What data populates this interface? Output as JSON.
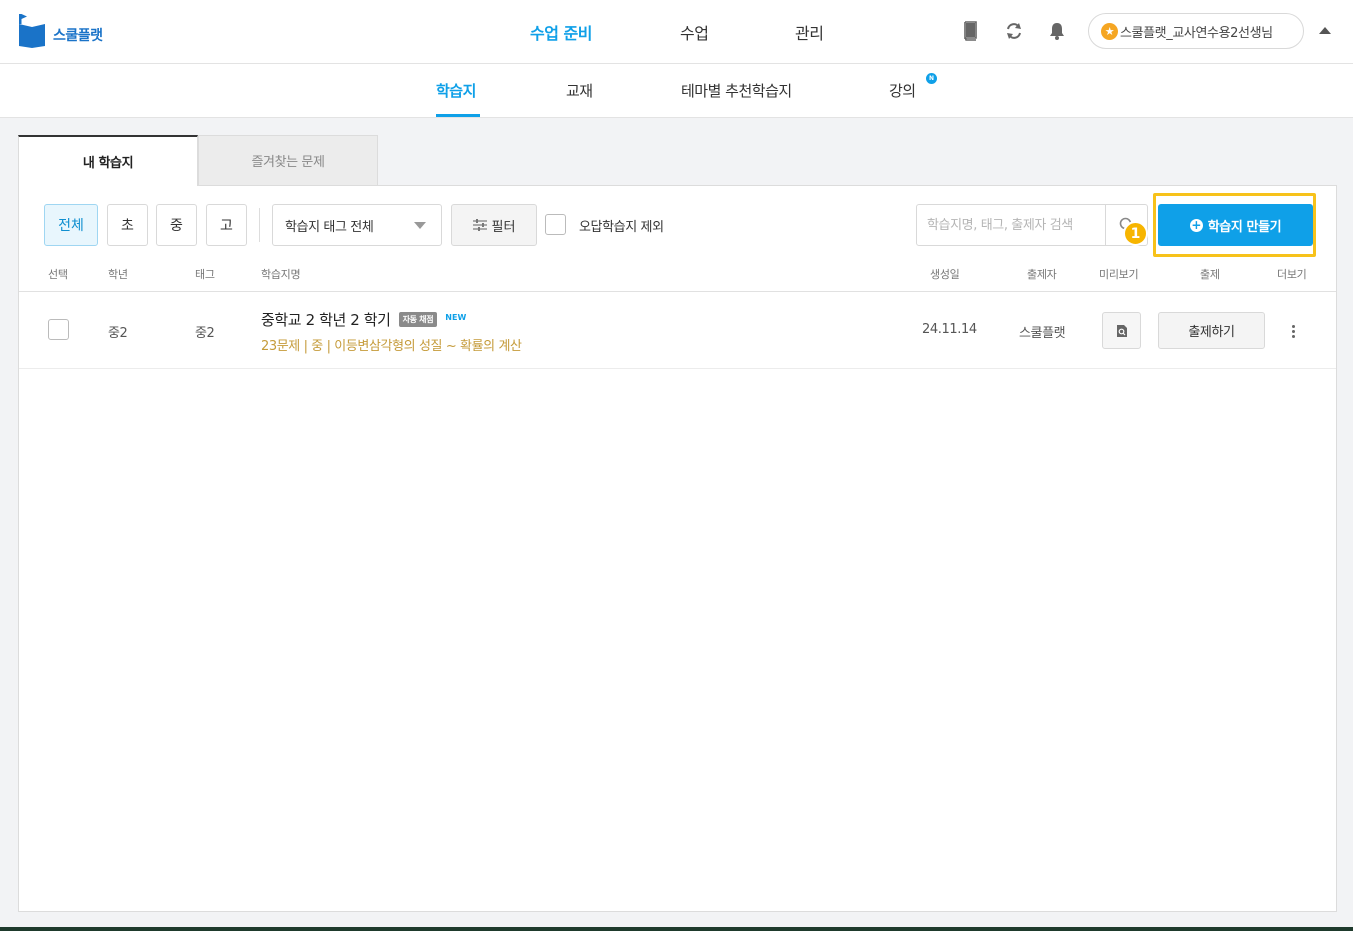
{
  "brand": {
    "name": "스쿨플랫"
  },
  "top_nav": [
    {
      "label": "수업 준비",
      "active": true
    },
    {
      "label": "수업",
      "active": false
    },
    {
      "label": "관리",
      "active": false
    }
  ],
  "header_icons": [
    "book-icon",
    "refresh-icon",
    "bell-icon"
  ],
  "user": {
    "name": "스쿨플랫_교사연수용2선생님"
  },
  "sub_nav": [
    {
      "label": "학습지",
      "active": true
    },
    {
      "label": "교재",
      "active": false
    },
    {
      "label": "테마별 추천학습지",
      "active": false
    },
    {
      "label": "강의",
      "active": false,
      "badge": "N"
    }
  ],
  "tabs": [
    {
      "label": "내 학습지",
      "active": true
    },
    {
      "label": "즐겨찾는 문제",
      "active": false
    }
  ],
  "toolbar": {
    "levels": [
      {
        "label": "전체",
        "active": true
      },
      {
        "label": "초",
        "active": false
      },
      {
        "label": "중",
        "active": false
      },
      {
        "label": "고",
        "active": false
      }
    ],
    "tag_select": "학습지 태그 전체",
    "filter_label": "필터",
    "exclude_wrong_label": "오답학습지 제외",
    "search_placeholder": "학습지명, 태그, 출제자 검색",
    "create_label": "학습지 만들기",
    "step_number": "1"
  },
  "table": {
    "headers": [
      "선택",
      "학년",
      "태그",
      "학습지명",
      "생성일",
      "출제자",
      "미리보기",
      "출제",
      "더보기"
    ],
    "rows": [
      {
        "grade": "중2",
        "tag": "중2",
        "title": "중학교 2 학년 2 학기",
        "auto_badge": "자동 채점",
        "new_badge": "NEW",
        "meta": "23문제 | 중 | 이등변삼각형의 성질 ~ 확률의 계산",
        "created": "24.11.14",
        "author": "스쿨플랫",
        "assign_label": "출제하기"
      }
    ]
  },
  "colors": {
    "accent": "#0fa0e8",
    "highlight": "#f7c21a",
    "meta": "#c59b3a"
  }
}
